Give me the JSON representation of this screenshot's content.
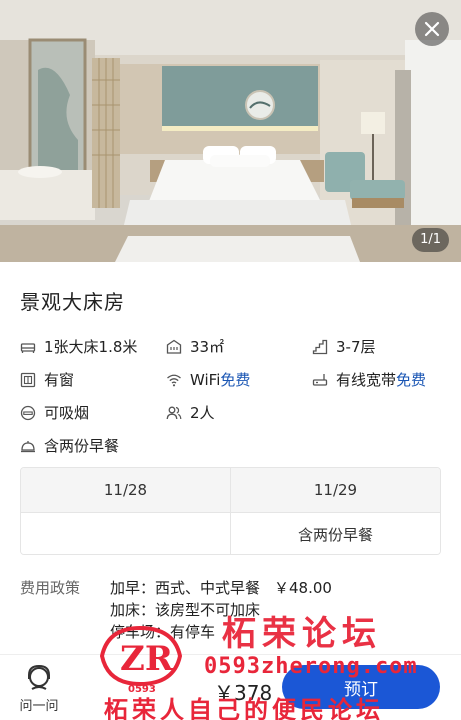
{
  "gallery": {
    "counter": "1/1",
    "close_icon": "close-icon"
  },
  "room": {
    "title": "景观大床房"
  },
  "facilities": {
    "bed": {
      "icon": "bed-icon",
      "text": "1张大床1.8米"
    },
    "area": {
      "icon": "area-icon",
      "text": "33㎡"
    },
    "floor": {
      "icon": "stairs-icon",
      "text": "3-7层"
    },
    "window": {
      "icon": "window-icon",
      "text": "有窗"
    },
    "wifi": {
      "icon": "wifi-icon",
      "label": "WiFi",
      "value": "免费"
    },
    "broadband": {
      "icon": "ethernet-icon",
      "label": "有线宽带",
      "value": "免费"
    },
    "smoking": {
      "icon": "smoking-icon",
      "text": "可吸烟"
    },
    "occupancy": {
      "icon": "people-icon",
      "text": "2人"
    },
    "breakfast": {
      "icon": "cloche-icon",
      "text": "含两份早餐"
    }
  },
  "dates": {
    "headers": [
      "11/28",
      "11/29"
    ],
    "values": [
      "",
      "含两份早餐"
    ]
  },
  "policy": {
    "label": "费用政策",
    "extra_breakfast_label": "加早：西式、中式早餐",
    "extra_breakfast_price": "￥48.00",
    "extra_bed": "加床：该房型不可加床",
    "parking": "停车场：有停车"
  },
  "watermark": {
    "title": "柘荣论坛",
    "url": "0593zherong.com",
    "slogan": "柘荣人自己的便民论坛",
    "logo_number": "0593"
  },
  "bottom": {
    "ask_label": "问一问",
    "total_price": "￥378",
    "book_label": "预订"
  },
  "colors": {
    "accent": "#1b57d6",
    "free_text": "#1a56b4",
    "watermark": "#e8263a"
  }
}
